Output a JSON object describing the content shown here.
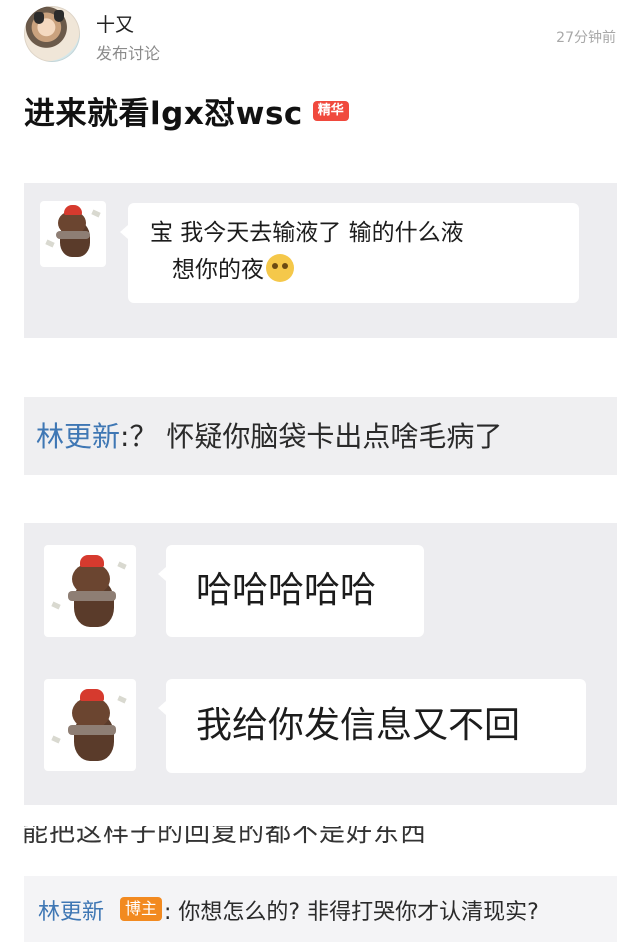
{
  "header": {
    "author": "十又",
    "post_type": "发布讨论",
    "timestamp": "27分钟前"
  },
  "post": {
    "title": "进来就看lgx怼wsc",
    "essence_badge": "精华"
  },
  "screenshots": {
    "chat1": {
      "line1": "宝  我今天去输液了   输的什么液",
      "line2": "想你的夜"
    },
    "comment1": {
      "name": "林更新",
      "text": ":？ 怀疑你脑袋卡出点啥毛病了"
    },
    "chat2": {
      "msg1": "哈哈哈哈哈",
      "msg2": "我给你发信息又不回"
    },
    "cutoff_text": "能把这样子的回复的都不是好东西"
  },
  "bottom_comment": {
    "name": "林更新",
    "badge": "博主",
    "text": ": 你想怎么的? 非得打哭你才认清现实?"
  },
  "icons": [
    "avatar-cat-photo",
    "bear-sticker-icon",
    "crying-emoji-icon"
  ]
}
